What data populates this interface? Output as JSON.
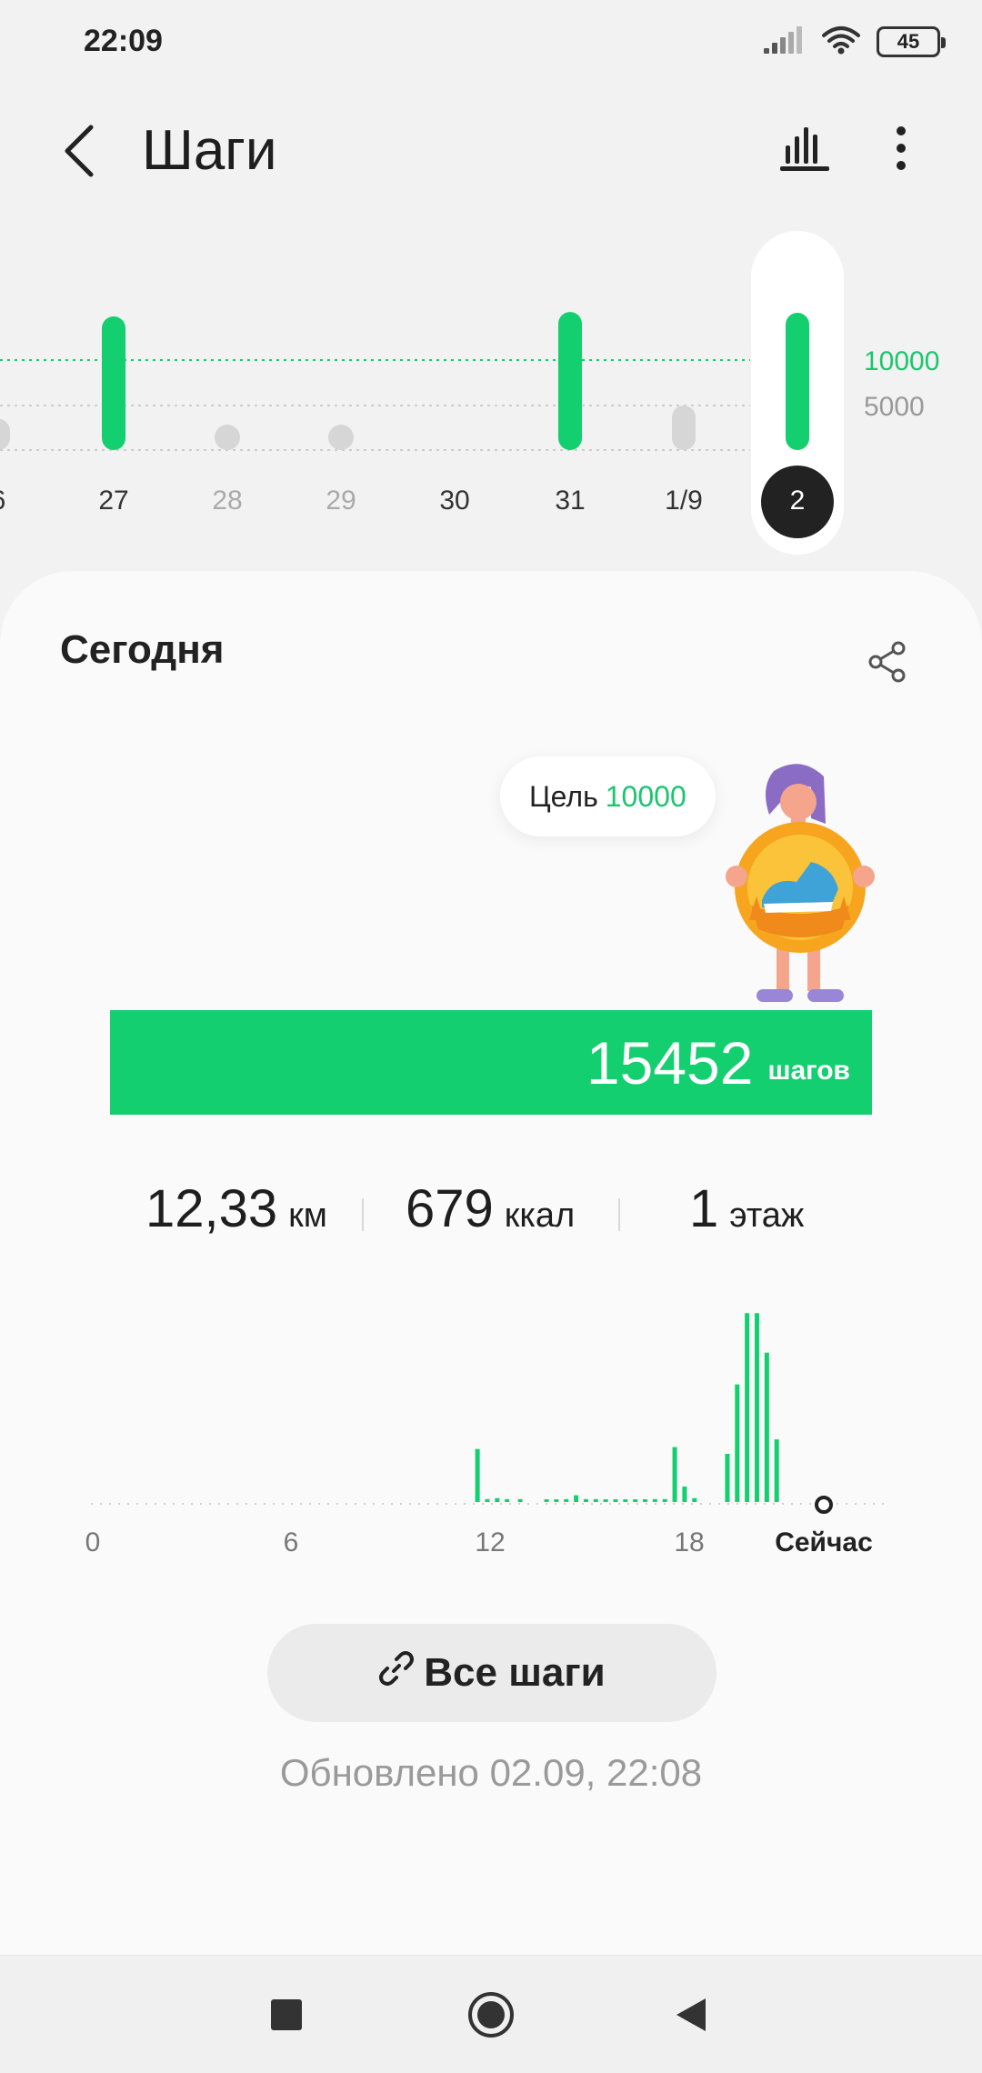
{
  "status_bar": {
    "time": "22:09",
    "battery": "45"
  },
  "header": {
    "title": "Шаги"
  },
  "icons": {
    "signal": "signal-icon",
    "wifi": "wifi-icon",
    "battery": "battery-icon",
    "back": "back-arrow-icon",
    "stats": "bar-chart-icon",
    "more": "more-vertical-icon",
    "share": "share-icon",
    "link": "link-icon",
    "nav_recents": "square-icon",
    "nav_home": "circle-icon",
    "nav_back": "triangle-icon"
  },
  "colors": {
    "accent": "#13cf6f",
    "inactive": "#d6d6d6",
    "selected_day": "#222222"
  },
  "week_chart": {
    "goal_label": "10000",
    "mid_label": "5000",
    "days": [
      {
        "label": "6",
        "steps": 3500,
        "state": "below"
      },
      {
        "label": "27",
        "steps": 15000,
        "state": "goal"
      },
      {
        "label": "28",
        "steps": 0,
        "state": "none"
      },
      {
        "label": "29",
        "steps": 0,
        "state": "none"
      },
      {
        "label": "30",
        "steps": null,
        "state": "empty"
      },
      {
        "label": "31",
        "steps": 15500,
        "state": "goal"
      },
      {
        "label": "1/9",
        "steps": 5000,
        "state": "below"
      },
      {
        "label": "2",
        "steps": 15452,
        "state": "goal",
        "selected": true
      }
    ]
  },
  "today": {
    "title": "Сегодня",
    "goal_label": "Цель",
    "goal_value": "10000",
    "steps_value": "15452",
    "steps_unit": "шагов",
    "progress_fraction": 1.0,
    "distance_value": "12,33",
    "distance_unit": "км",
    "calories_value": "679",
    "calories_unit": "ккал",
    "floors_value": "1",
    "floors_unit": "этаж"
  },
  "chart_data": {
    "type": "bar",
    "x_ticks": [
      "0",
      "6",
      "12",
      "18",
      "Сейчас"
    ],
    "xlim": [
      0,
      22.15
    ],
    "x": [
      11.7,
      12.0,
      12.3,
      12.6,
      13.0,
      13.8,
      14.1,
      14.4,
      14.7,
      15.0,
      15.3,
      15.6,
      15.9,
      16.2,
      16.5,
      16.8,
      17.1,
      17.4,
      17.7,
      18.0,
      18.3,
      19.3,
      19.6,
      19.9,
      20.2,
      20.5,
      20.8
    ],
    "values": [
      5.5,
      0.3,
      0.4,
      0.3,
      0.3,
      0.2,
      0.2,
      0.3,
      0.7,
      0.3,
      0.3,
      0.2,
      0.2,
      0.2,
      0.2,
      0.2,
      0.3,
      0.3,
      5.7,
      1.6,
      0.4,
      5.0,
      12.2,
      19.6,
      19.6,
      15.5,
      6.5
    ],
    "ylim": [
      0,
      20
    ]
  },
  "actions": {
    "all_steps": "Все шаги"
  },
  "updated_text": "Обновлено 02.09, 22:08"
}
